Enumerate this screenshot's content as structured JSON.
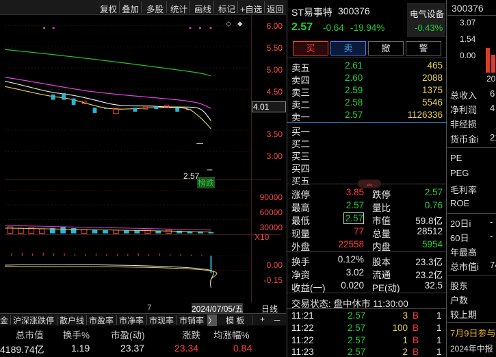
{
  "toolbar": {
    "items": [
      "复权",
      "叠加",
      "多股",
      "统计",
      "画线",
      "标记",
      "+自选",
      "返回"
    ]
  },
  "kline": {
    "price_ticks": [
      "6.00",
      "5.50",
      "5.00",
      "4.50",
      "3.50",
      "3.00"
    ],
    "current_price_tag": "4.01",
    "marker_price": "2.57",
    "marker_badge": "榜跌",
    "volume_ticks": [
      "90000",
      "60000",
      "30000"
    ],
    "volume_multiplier": "X10",
    "macd_ticks": [
      "0.00",
      "-0.15"
    ],
    "date_label": "7",
    "cursor_date": "2024/07/05/五",
    "daily_line_label": "日线"
  },
  "tabs": {
    "items": [
      "金",
      "沪深涨跌停",
      "散户线",
      "市盈率",
      "市净率",
      "市现率",
      "市销率"
    ],
    "arrow": "〉",
    "template": "模 板",
    "plus": "+",
    "minus": "－"
  },
  "bottom_stats": {
    "headers": [
      "总市值",
      "换手%",
      "市盈(动)",
      "涨跌",
      "均涨幅%"
    ],
    "values": [
      "4189.74亿",
      "1.19",
      "23.37",
      "23.34",
      "0.84"
    ]
  },
  "quote": {
    "name": "ST易事特",
    "code": "300376",
    "sector": "电气设备",
    "sector_change": "-0.43%",
    "price": "2.57",
    "change": "-0.64",
    "change_pct": "-19.94%",
    "buttons": [
      "买",
      "卖",
      "撤",
      "警"
    ],
    "asks": [
      {
        "label": "卖五",
        "price": "2.61",
        "vol": "465"
      },
      {
        "label": "卖四",
        "price": "2.60",
        "vol": "2088"
      },
      {
        "label": "卖三",
        "price": "2.59",
        "vol": "1375"
      },
      {
        "label": "卖二",
        "price": "2.58",
        "vol": "5546"
      },
      {
        "label": "卖一",
        "price": "2.57",
        "vol": "1126336"
      }
    ],
    "bids": [
      "买一",
      "买二",
      "买三",
      "买四",
      "买五"
    ],
    "stats": [
      {
        "l1": "涨停",
        "v1": "3.85",
        "l2": "跌停",
        "v2": "2.57"
      },
      {
        "l1": "最高",
        "v1": "2.57",
        "l2": "量比",
        "v2": "0.76"
      },
      {
        "l1": "最低",
        "v1": "2.57",
        "l2": "市值",
        "v2": "59.8亿"
      },
      {
        "l1": "现量",
        "v1": "77",
        "l2": "总量",
        "v2": "28512"
      },
      {
        "l1": "外盘",
        "v1": "22558",
        "l2": "内盘",
        "v2": "5954"
      }
    ],
    "stats2": [
      {
        "l1": "换手",
        "v1": "0.12%",
        "l2": "股本",
        "v2": "23.3亿"
      },
      {
        "l1": "净资",
        "v1": "3.02",
        "l2": "流通",
        "v2": "23.2亿"
      },
      {
        "l1": "收益(一)",
        "v1": "0.020",
        "l2": "PE(动)",
        "v2": "32.5"
      }
    ],
    "trade_status": "交易状态: 盘中休市 11:30:00",
    "ticks": [
      {
        "time": "11:21",
        "price": "2.57",
        "vol": "3",
        "side": "B",
        "n": "1"
      },
      {
        "time": "11:22",
        "price": "2.57",
        "vol": "100",
        "side": "B",
        "n": "1"
      },
      {
        "time": "11:22",
        "price": "2.57",
        "vol": "1",
        "side": "B",
        "n": "1"
      },
      {
        "time": "11:23",
        "price": "2.57",
        "vol": "2",
        "side": "B",
        "n": "1"
      }
    ]
  },
  "far_right": {
    "code": "300376",
    "ticks": [
      "3.07",
      "1.54",
      "0.00"
    ],
    "year": "20",
    "labels": [
      "总收入",
      "净利润",
      "非经损",
      "货币金i",
      "PE",
      "PEG",
      "毛利率",
      "ROE",
      "20日i",
      "60日",
      "年最高",
      "总市值i",
      "股东",
      "户数",
      "较上期"
    ],
    "values": [
      "6",
      "4",
      "",
      "21",
      "",
      "",
      "",
      "",
      "-",
      "-",
      "",
      "74",
      "",
      "",
      ""
    ],
    "news": [
      "7月9日参与",
      "2024年中报"
    ]
  }
}
